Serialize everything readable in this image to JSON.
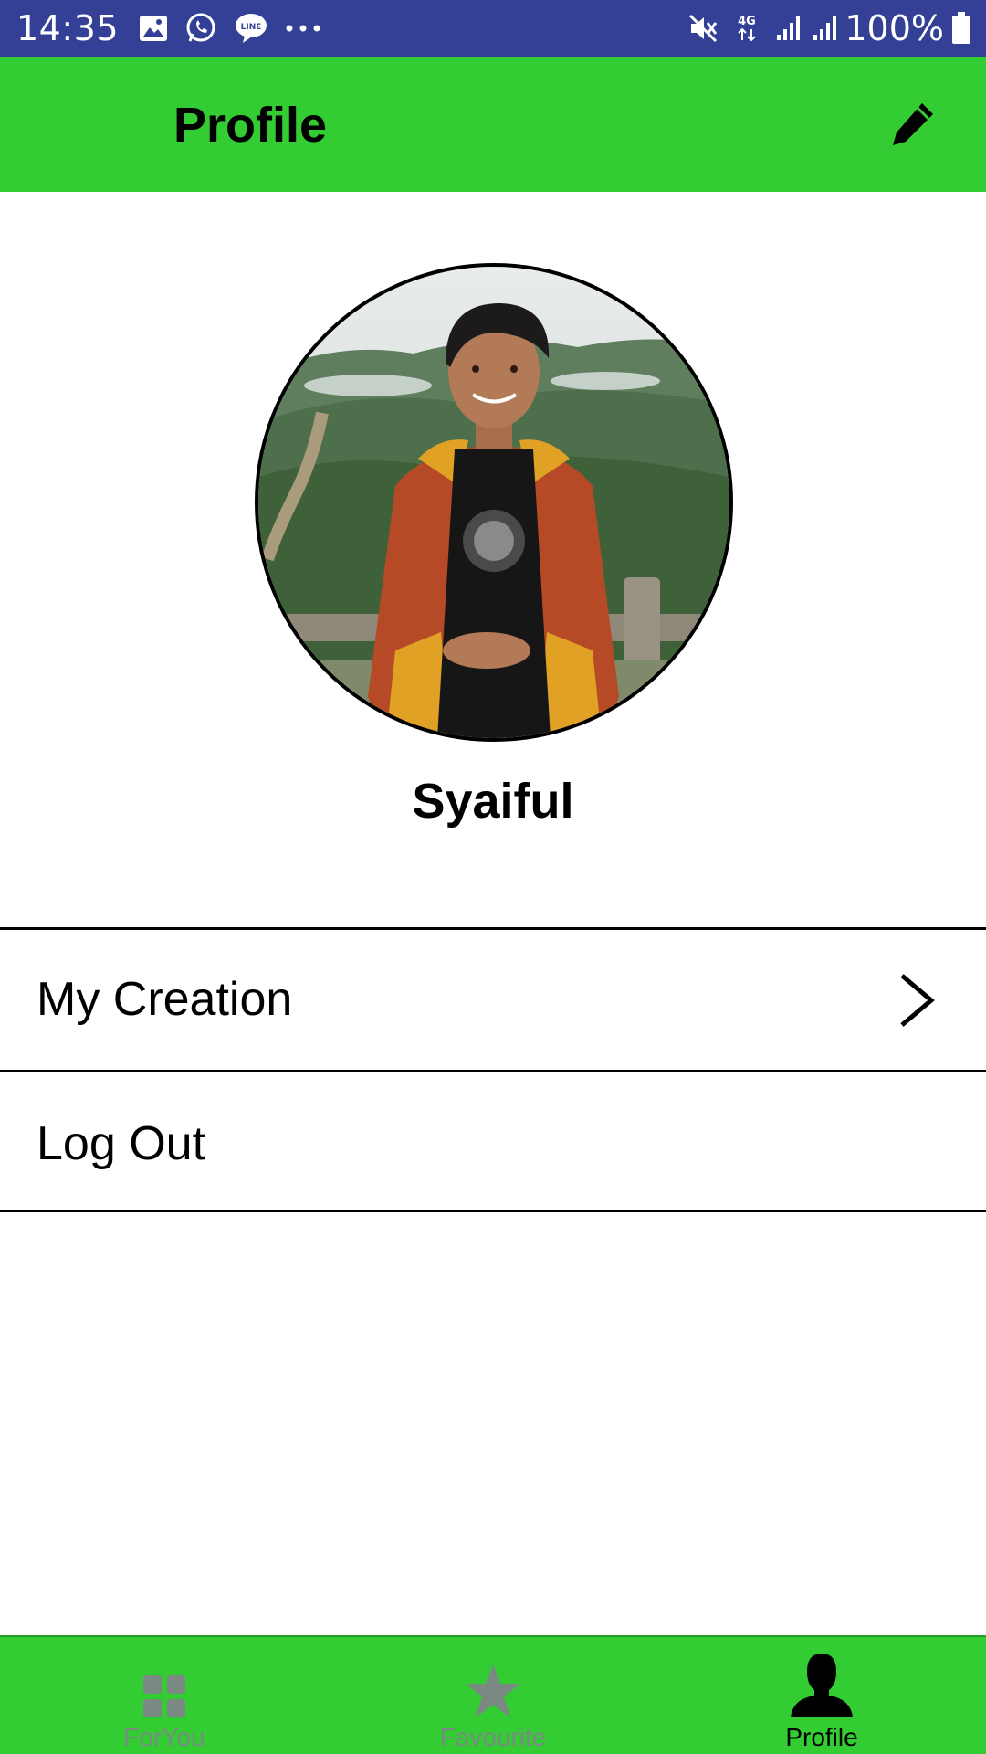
{
  "status_bar": {
    "time": "14:35",
    "left_icons": [
      "gallery-icon",
      "whatsapp-icon",
      "line-icon",
      "more-dots-icon"
    ],
    "right_icons": [
      "mute-icon",
      "4g-icon",
      "signal-icon",
      "signal-icon",
      "battery-icon"
    ],
    "network": "4G",
    "battery": "100%"
  },
  "app_bar": {
    "title": "Profile",
    "action_icon": "pencil-icon"
  },
  "profile": {
    "name": "Syaiful"
  },
  "menu": {
    "items": [
      {
        "label": "My Creation",
        "icon": "chevron-right-icon"
      },
      {
        "label": "Log Out"
      }
    ]
  },
  "bottom_nav": {
    "items": [
      {
        "label": "ForYou",
        "icon": "grid-icon",
        "active": false
      },
      {
        "label": "Favourite",
        "icon": "star-icon",
        "active": false
      },
      {
        "label": "Profile",
        "icon": "person-icon",
        "active": true
      }
    ]
  },
  "colors": {
    "status_bar": "#334096",
    "accent_green": "#33cc33",
    "inactive_nav": "#7a8a82",
    "text": "#000000"
  }
}
